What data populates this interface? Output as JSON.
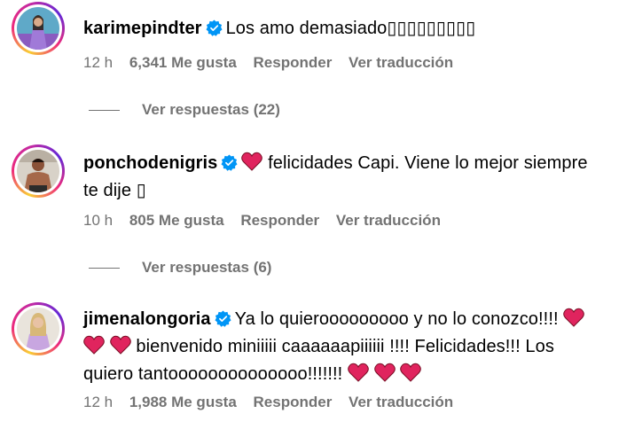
{
  "comments": [
    {
      "username": "karimepindter",
      "text": "Los amo demasiado▯▯▯▯▯▯▯▯▯",
      "time": "12 h",
      "likes": "6,341 Me gusta",
      "reply_label": "Responder",
      "translate_label": "Ver traducción",
      "view_replies": "Ver respuestas (22)"
    },
    {
      "username": "ponchodenigris",
      "text_after_heart": "felicidades Capi. Viene lo mejor siempre",
      "text_line2": "te dije ▯",
      "time": "10 h",
      "likes": "805 Me gusta",
      "reply_label": "Responder",
      "translate_label": "Ver traducción",
      "view_replies": "Ver respuestas (6)"
    },
    {
      "username": "jimenalongoria",
      "text_part1": "Ya lo quierooooooooo y no lo conozco!!!!",
      "text_part2": "bienvenido miniiiii caaaaaapiiiiii !!!! Felicidades!!! Los",
      "text_part3": "quiero tantoooooooooooooo!!!!!!!",
      "time": "12 h",
      "likes": "1,988 Me gusta",
      "reply_label": "Responder",
      "translate_label": "Ver traducción"
    }
  ],
  "colors": {
    "verified": "#0095f6",
    "heart": "#e0245e",
    "meta_text": "#737373"
  },
  "icons": [
    "verified-badge-icon",
    "red-heart-icon"
  ]
}
